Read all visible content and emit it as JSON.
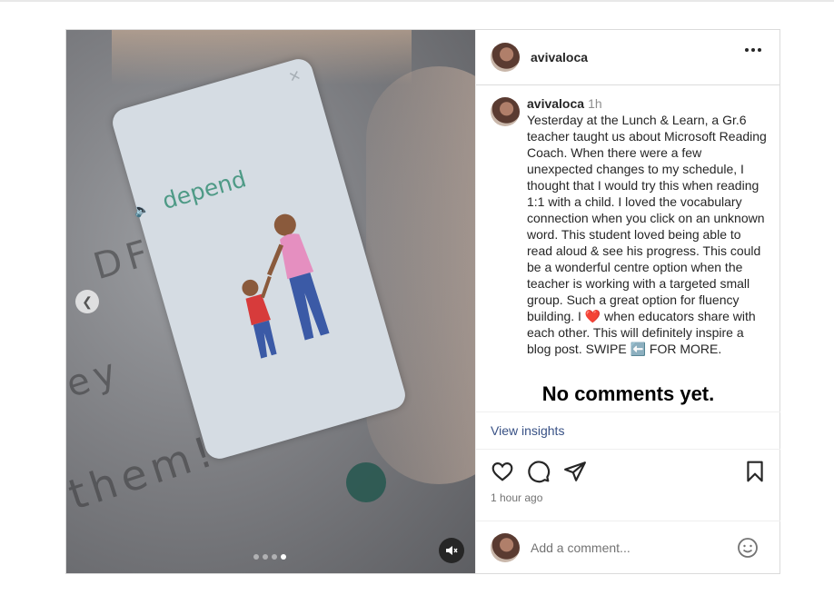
{
  "post": {
    "author": "avivaloca",
    "caption": {
      "username": "avivaloca",
      "time": "1h",
      "text": "Yesterday at the Lunch & Learn, a Gr.6 teacher taught us about Microsoft Reading Coach. When there were a few unexpected changes to my schedule, I thought that I would try this when reading 1:1 with a child. I loved the vocabulary connection when you click on an unknown word. This student loved being able to read aloud & see his progress. This could be a wonderful centre option when the teacher is working with a targeted small group. Such a great option for fluency building. I ❤️ when educators share with each other. This will definitely inspire a blog post. SWIPE ⬅️ FOR MORE."
    },
    "no_comments": "No comments yet.",
    "view_insights": "View insights",
    "timestamp": "1 hour ago",
    "add_comment_placeholder": "Add a comment...",
    "media": {
      "card_word": "depend",
      "background_words": [
        "DF",
        "ey",
        "them!"
      ],
      "slide_count": 4,
      "active_slide": 4,
      "muted": true
    }
  },
  "icons": {
    "more": "more-options-icon",
    "prev": "chevron-left-icon",
    "mute": "muted-speaker-icon",
    "like": "heart-icon",
    "comment": "comment-icon",
    "share": "send-icon",
    "save": "bookmark-icon",
    "emoji": "emoji-icon"
  }
}
